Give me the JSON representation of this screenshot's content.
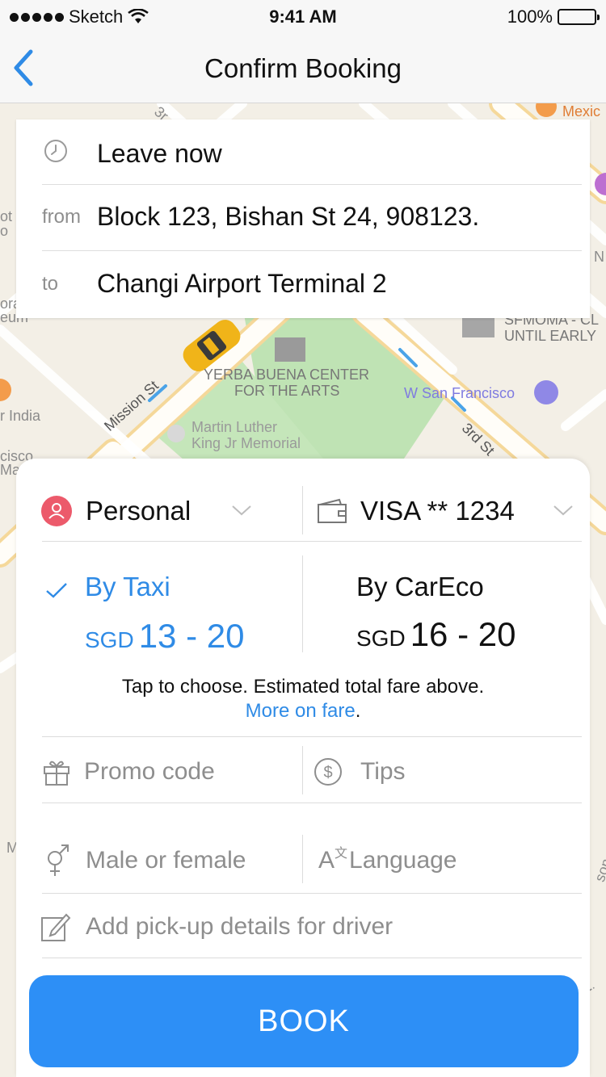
{
  "status_bar": {
    "carrier": "Sketch",
    "time": "9:41 AM",
    "battery": "100%"
  },
  "nav": {
    "title": "Confirm Booking"
  },
  "map": {
    "labels": {
      "mexico": "Mexic",
      "sfmoma": "SFMOMA - CL",
      "until_early": "UNTIL EARLY",
      "yerba_1": "YERBA BUENA CENTER",
      "yerba_2": "FOR THE ARTS",
      "w_sf": "W San Francisco",
      "mlk_1": "Martin Luther",
      "mlk_2": "King Jr Memorial",
      "mission": "Mission St",
      "third": "3rd St",
      "india": "r India",
      "cisco": "cisco",
      "ma": "Ma",
      "ot": "ot",
      "o": "o",
      "ora": "ora",
      "eum": "eum",
      "m": "M",
      "son": "son",
      "n": "N",
      "three": "3r",
      "ini": "ini"
    }
  },
  "trip": {
    "time_label": "Leave now",
    "from_label": "from",
    "from_value": "Block 123, Bishan St 24, 908123.",
    "to_label": "to",
    "to_value": "Changi Airport Terminal 2"
  },
  "sheet": {
    "profile": "Personal",
    "payment": "VISA ** 1234",
    "options": [
      {
        "title": "By Taxi",
        "currency": "SGD",
        "range": "13 - 20",
        "selected": true
      },
      {
        "title": "By CarEco",
        "currency": "SGD",
        "range": "16 - 20",
        "selected": false
      }
    ],
    "note": "Tap to choose. Estimated total fare above.",
    "more_link": "More on fare",
    "more_suffix": ".",
    "promo": "Promo code",
    "tips": "Tips",
    "gender": "Male or female",
    "language": "Language",
    "pickup_details": "Add pick-up details for driver",
    "book": "BOOK"
  },
  "colors": {
    "accent": "#2f8be6",
    "book_button": "#2d8ff6",
    "profile_badge": "#ec5a6b",
    "map_bg": "#f3efe6",
    "park": "#bfe3b4"
  }
}
